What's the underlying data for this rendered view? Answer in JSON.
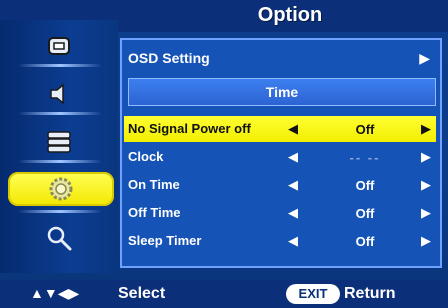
{
  "header": {
    "title": "Option"
  },
  "sidebar": {
    "items": [
      {
        "icon": "picture-icon",
        "selected": false
      },
      {
        "icon": "speaker-icon",
        "selected": false
      },
      {
        "icon": "layers-icon",
        "selected": false
      },
      {
        "icon": "gear-icon",
        "selected": true
      },
      {
        "icon": "magnifier-icon",
        "selected": false
      }
    ]
  },
  "main": {
    "osd_setting_label": "OSD Setting",
    "section_title": "Time",
    "rows": [
      {
        "label": "No Signal Power off",
        "value": "Off",
        "selected": true
      },
      {
        "label": "Clock",
        "value": "-- --",
        "selected": false
      },
      {
        "label": "On Time",
        "value": "Off",
        "selected": false
      },
      {
        "label": "Off Time",
        "value": "Off",
        "selected": false
      },
      {
        "label": "Sleep Timer",
        "value": "Off",
        "selected": false
      }
    ]
  },
  "footer": {
    "nav_glyphs": "▲▼◀▶",
    "select_label": "Select",
    "exit_label": "EXIT",
    "return_label": "Return"
  },
  "colors": {
    "highlight": "#ffff33",
    "background": "#0b3a86",
    "header": "#0b2f78"
  }
}
